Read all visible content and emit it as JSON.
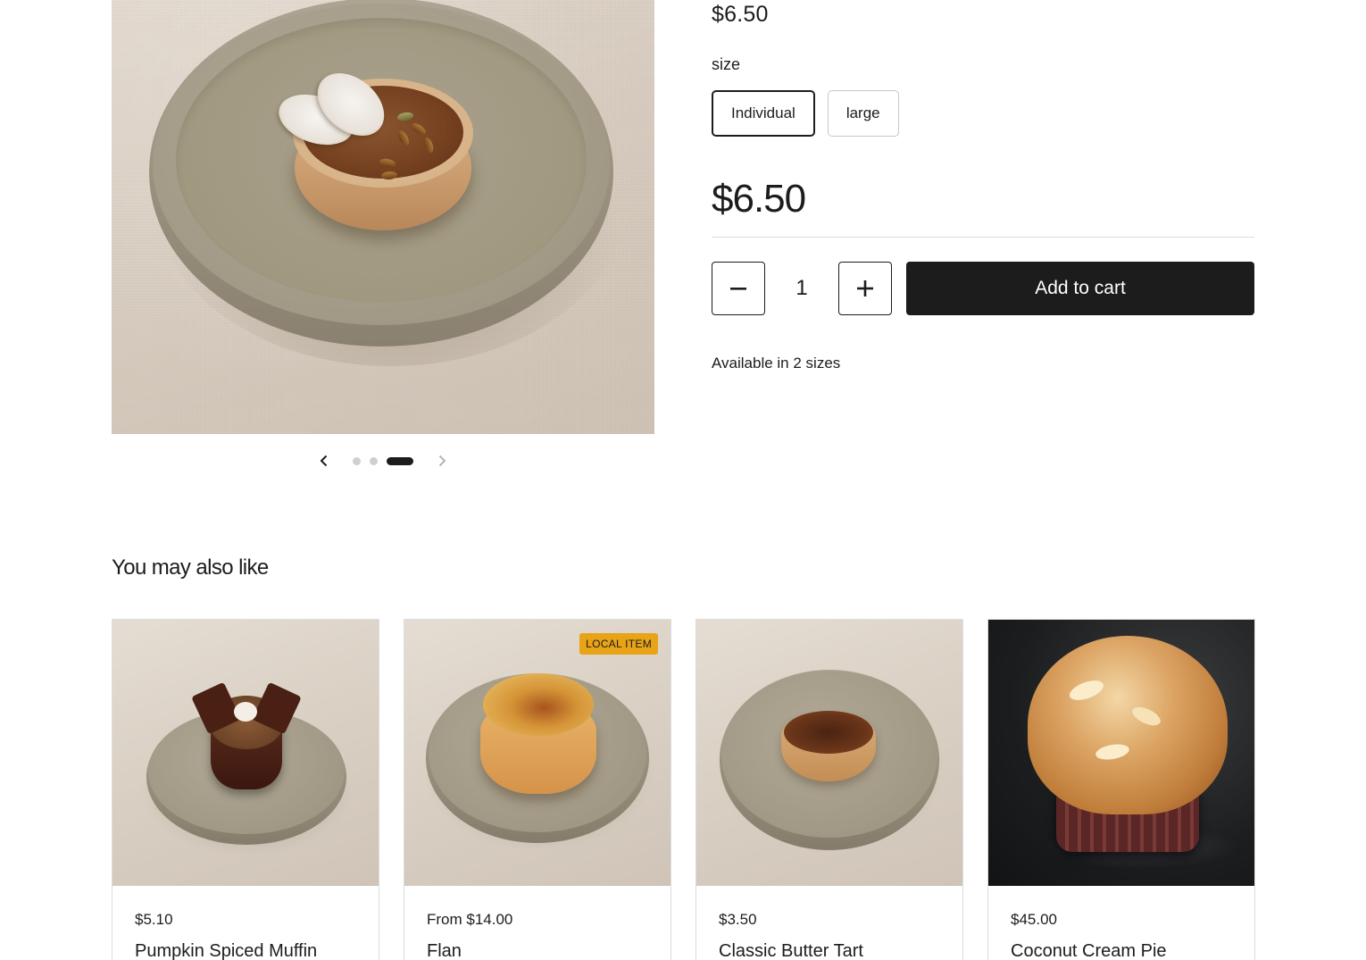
{
  "product": {
    "price_top": "$6.50",
    "option_label": "size",
    "options": [
      "Individual",
      "large"
    ],
    "selected_option": "Individual",
    "price": "$6.50",
    "quantity": "1",
    "add_to_cart_label": "Add to cart",
    "availability": "Available in 2 sizes"
  },
  "gallery": {
    "slide_count": 3,
    "active_slide": 3,
    "prev_icon": "chevron-left-icon",
    "next_icon": "chevron-right-icon"
  },
  "recommendations": {
    "title": "You may also like",
    "items": [
      {
        "price": "$5.10",
        "name": "Pumpkin Spiced Muffin",
        "badge": ""
      },
      {
        "price": "From $14.00",
        "name": "Flan",
        "badge": "LOCAL ITEM"
      },
      {
        "price": "$3.50",
        "name": "Classic Butter Tart",
        "badge": ""
      },
      {
        "price": "$45.00",
        "name": "Coconut Cream Pie",
        "badge": ""
      }
    ]
  },
  "colors": {
    "text": "#1c1c1c",
    "button_bg": "#1c1c1c",
    "button_text": "#ffffff",
    "badge_bg": "#e8a317",
    "border": "#dcdcdc"
  }
}
